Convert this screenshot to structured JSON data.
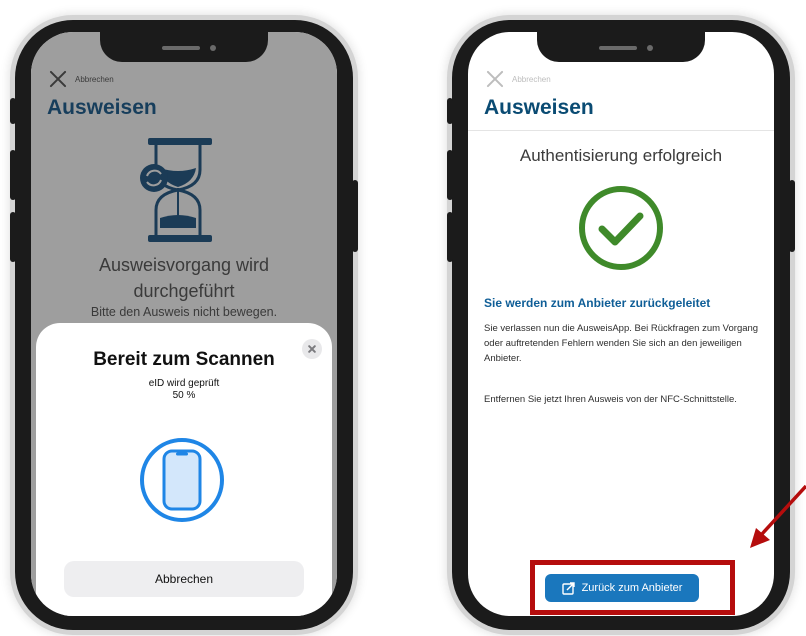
{
  "left_screen": {
    "cancel_label": "Abbrechen",
    "title": "Ausweisen",
    "status_line1": "Ausweisvorgang wird",
    "status_line2": "durchgeführt",
    "instruction": "Bitte den Ausweis nicht bewegen.",
    "icon": "hourglass-icon",
    "scan_sheet": {
      "title": "Bereit zum Scannen",
      "line1": "eID wird geprüft",
      "progress_text": "50 %",
      "progress": 50,
      "cancel_button": "Abbrechen",
      "icon": "phone-scan-icon"
    }
  },
  "right_screen": {
    "cancel_label": "Abbrechen",
    "title": "Ausweisen",
    "heading": "Authentisierung erfolgreich",
    "icon": "success-check-icon",
    "subheading": "Sie werden zum Anbieter zurückgeleitet",
    "paragraph1": "Sie verlassen nun die AusweisApp. Bei Rückfragen zum Vorgang oder auftretenden Fehlern wenden Sie sich an den jeweiligen Anbieter.",
    "paragraph2": "Entfernen Sie jetzt Ihren Ausweis von der NFC-Schnittstelle.",
    "back_button": "Zurück zum Anbieter"
  },
  "colors": {
    "brand_blue": "#0a4b73",
    "link_blue": "#0f5e97",
    "button_blue": "#1a77bd",
    "success_green": "#3f8a2a",
    "scan_blue": "#1f86e6",
    "annotation_red": "#b50d0d"
  }
}
